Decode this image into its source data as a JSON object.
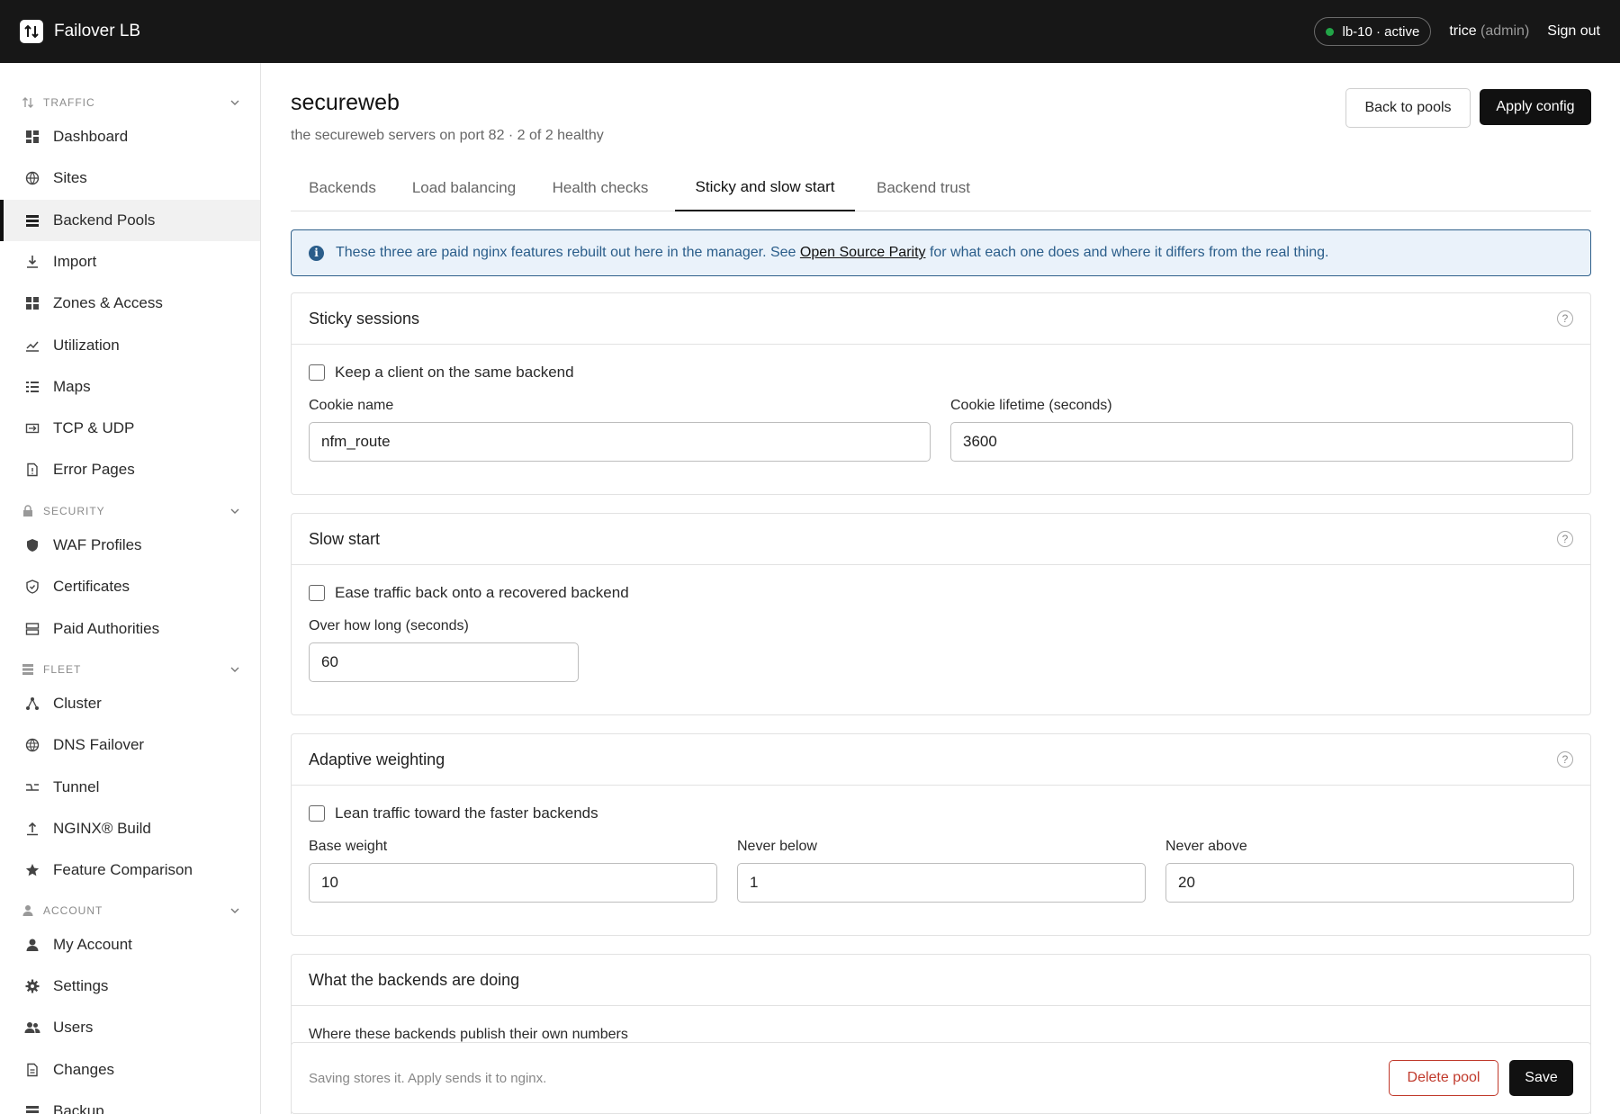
{
  "topbar": {
    "app_name": "Failover LB",
    "status": "lb-10 · active",
    "user_name": "trice",
    "user_role": "(admin)",
    "signout": "Sign out",
    "status_color": "#22a447"
  },
  "sidebar": {
    "sections": [
      {
        "label": "TRAFFIC",
        "items": [
          "Dashboard",
          "Sites",
          "Backend Pools",
          "Import",
          "Zones & Access",
          "Utilization",
          "Maps",
          "TCP & UDP",
          "Error Pages"
        ]
      },
      {
        "label": "SECURITY",
        "items": [
          "WAF Profiles",
          "Certificates",
          "Paid Authorities"
        ]
      },
      {
        "label": "FLEET",
        "items": [
          "Cluster",
          "DNS Failover",
          "Tunnel",
          "NGINX® Build",
          "Feature Comparison"
        ]
      },
      {
        "label": "ACCOUNT",
        "items": [
          "My Account",
          "Settings",
          "Users",
          "Changes",
          "Backup"
        ]
      }
    ],
    "active_item": "Backend Pools"
  },
  "page": {
    "title": "secureweb",
    "subtitle": "the secureweb servers on port 82 · 2 of 2 healthy",
    "back_button": "Back to pools",
    "apply_button": "Apply config"
  },
  "tabs": [
    "Backends",
    "Load balancing",
    "Health checks",
    "Sticky and slow start",
    "Backend trust"
  ],
  "active_tab": "Sticky and slow start",
  "notice": {
    "before": "These three are paid nginx features rebuilt out here in the manager. See ",
    "link": "Open Source Parity",
    "after": " for what each one does and where it differs from the real thing."
  },
  "sticky": {
    "title": "Sticky sessions",
    "checkbox_label": "Keep a client on the same backend",
    "enabled": false,
    "cookie_name_label": "Cookie name",
    "cookie_name": "nfm_route",
    "cookie_lifetime_label": "Cookie lifetime (seconds)",
    "cookie_lifetime": "3600"
  },
  "slow_start": {
    "title": "Slow start",
    "checkbox_label": "Ease traffic back onto a recovered backend",
    "enabled": false,
    "duration_label": "Over how long (seconds)",
    "duration": "60"
  },
  "adaptive": {
    "title": "Adaptive weighting",
    "checkbox_label": "Lean traffic toward the faster backends",
    "enabled": false,
    "base_label": "Base weight",
    "base": "10",
    "min_label": "Never below",
    "min": "1",
    "max_label": "Never above",
    "max": "20"
  },
  "backends_doing": {
    "title": "What the backends are doing",
    "sub_label": "Where these backends publish their own numbers"
  },
  "footer": {
    "note": "Saving stores it. Apply sends it to nginx.",
    "delete_button": "Delete pool",
    "save_button": "Save"
  }
}
